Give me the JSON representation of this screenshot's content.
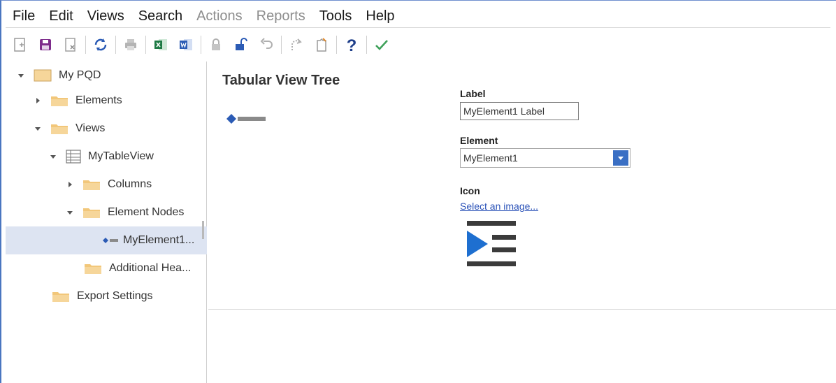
{
  "menu": [
    {
      "label": "File",
      "enabled": true
    },
    {
      "label": "Edit",
      "enabled": true
    },
    {
      "label": "Views",
      "enabled": true
    },
    {
      "label": "Search",
      "enabled": true
    },
    {
      "label": "Actions",
      "enabled": false
    },
    {
      "label": "Reports",
      "enabled": false
    },
    {
      "label": "Tools",
      "enabled": true
    },
    {
      "label": "Help",
      "enabled": true
    }
  ],
  "toolbar": {
    "icons": [
      "new-icon",
      "save-icon",
      "delete-icon",
      "refresh-icon",
      "print-icon",
      "excel-icon",
      "word-icon",
      "lock-icon",
      "unlock-icon",
      "undo-icon",
      "redo-icon",
      "paste-icon",
      "help-icon",
      "check-icon"
    ]
  },
  "tree": {
    "root": "My PQD",
    "elements": "Elements",
    "views": "Views",
    "table_view": "MyTableView",
    "columns": "Columns",
    "element_nodes": "Element Nodes",
    "element_node": "MyElement1...",
    "additional_headers": "Additional Hea...",
    "export_settings": "Export Settings"
  },
  "editor": {
    "title": "Tabular View Tree",
    "label_caption": "Label",
    "label_value": "MyElement1 Label",
    "element_caption": "Element",
    "element_value": "MyElement1",
    "icon_caption": "Icon",
    "icon_link": "Select an image..."
  },
  "colors": {
    "accent": "#3a6fc4",
    "folder": "#f2c77a",
    "selected_row": "#dde4f2",
    "check": "#3fa15a",
    "excel": "#1e7a44",
    "word": "#2b5bb5",
    "save": "#7d2b8b"
  }
}
